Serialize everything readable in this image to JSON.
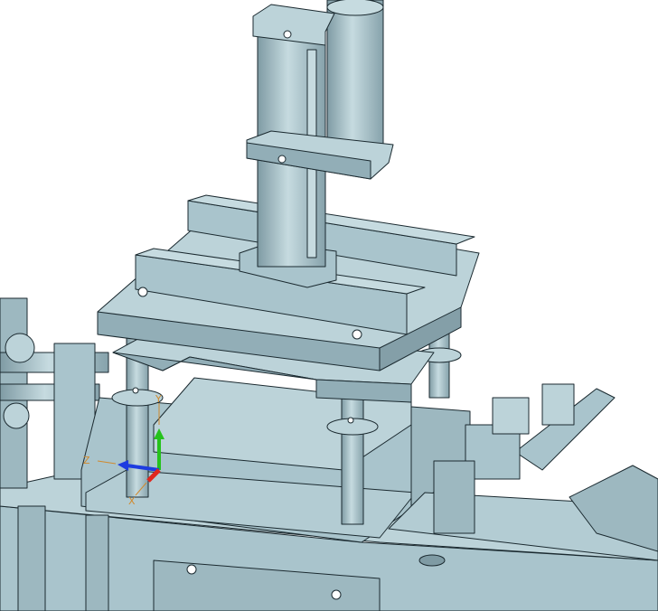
{
  "viewport": {
    "background": "#ffffff",
    "model_fill": "#a9c4cc",
    "model_fill_light": "#bcd3d9",
    "model_fill_dark": "#7f9ba4",
    "edge_color": "#1b2a30"
  },
  "triad": {
    "x_label": "X",
    "y_label": "Y",
    "z_label": "Z",
    "x_color": "#e0261d",
    "y_color": "#25c21c",
    "z_color": "#1d3ce0",
    "label_color": "#d08a2e"
  }
}
